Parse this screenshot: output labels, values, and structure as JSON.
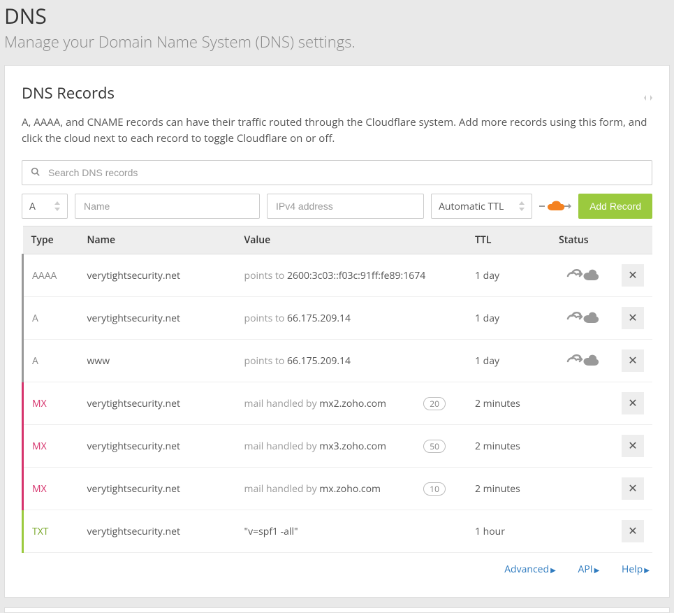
{
  "header": {
    "title": "DNS",
    "subtitle": "Manage your Domain Name System (DNS) settings."
  },
  "panel": {
    "title": "DNS Records",
    "description": "A, AAAA, and CNAME records can have their traffic routed through the Cloudflare system. Add more records using this form, and click the cloud next to each record to toggle Cloudflare on or off."
  },
  "search": {
    "placeholder": "Search DNS records"
  },
  "add": {
    "type": "A",
    "name_placeholder": "Name",
    "value_placeholder": "IPv4 address",
    "ttl": "Automatic TTL",
    "button": "Add Record"
  },
  "columns": {
    "type": "Type",
    "name": "Name",
    "value": "Value",
    "ttl": "TTL",
    "status": "Status"
  },
  "records": [
    {
      "type": "AAAA",
      "type_class": "gray",
      "name": "verytightsecurity.net",
      "prefix": "points to ",
      "value": "2600:3c03::f03c:91ff:fe89:1674",
      "priority": "",
      "ttl": "1 day",
      "status": "cloud-off"
    },
    {
      "type": "A",
      "type_class": "gray",
      "name": "verytightsecurity.net",
      "prefix": "points to ",
      "value": "66.175.209.14",
      "priority": "",
      "ttl": "1 day",
      "status": "cloud-off"
    },
    {
      "type": "A",
      "type_class": "gray",
      "name": "www",
      "prefix": "points to ",
      "value": "66.175.209.14",
      "priority": "",
      "ttl": "1 day",
      "status": "cloud-off"
    },
    {
      "type": "MX",
      "type_class": "pink",
      "name": "verytightsecurity.net",
      "prefix": "mail handled by ",
      "value": "mx2.zoho.com",
      "priority": "20",
      "ttl": "2 minutes",
      "status": ""
    },
    {
      "type": "MX",
      "type_class": "pink",
      "name": "verytightsecurity.net",
      "prefix": "mail handled by ",
      "value": "mx3.zoho.com",
      "priority": "50",
      "ttl": "2 minutes",
      "status": ""
    },
    {
      "type": "MX",
      "type_class": "pink",
      "name": "verytightsecurity.net",
      "prefix": "mail handled by ",
      "value": "mx.zoho.com",
      "priority": "10",
      "ttl": "2 minutes",
      "status": ""
    },
    {
      "type": "TXT",
      "type_class": "green",
      "name": "verytightsecurity.net",
      "prefix": "",
      "value": "\"v=spf1 -all\"",
      "priority": "",
      "ttl": "1 hour",
      "status": ""
    }
  ],
  "footer": {
    "advanced": "Advanced",
    "api": "API",
    "help": "Help"
  }
}
